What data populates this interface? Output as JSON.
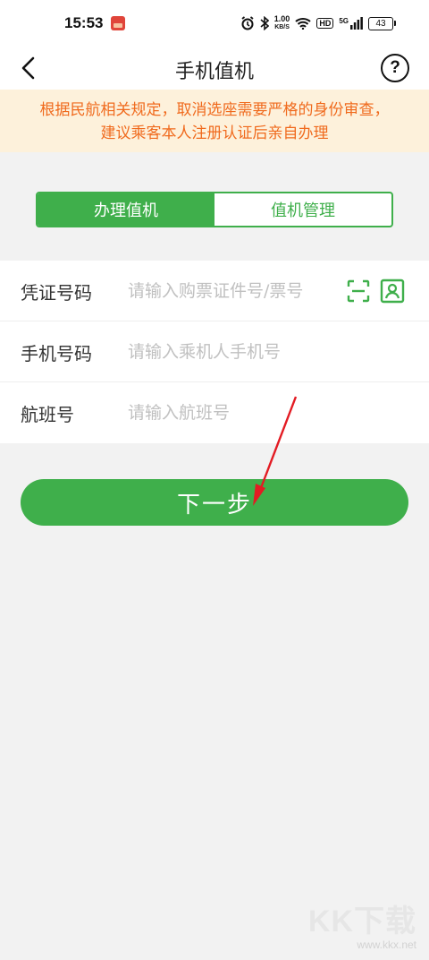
{
  "status_bar": {
    "time": "15:53",
    "speed_value": "1.00",
    "speed_unit": "KB/S",
    "hd": "HD",
    "network": "5G",
    "battery": "43"
  },
  "nav": {
    "title": "手机值机",
    "help_symbol": "?"
  },
  "notice": {
    "line1": "根据民航相关规定，取消选座需要严格的身份审查，",
    "line2": "建议乘客本人注册认证后亲自办理",
    "color": "#f06a1d",
    "background": "#fdf1db"
  },
  "tabs": [
    {
      "label": "办理值机",
      "active": true
    },
    {
      "label": "值机管理",
      "active": false
    }
  ],
  "form": {
    "ticket": {
      "label": "凭证号码",
      "placeholder": "请输入购票证件号/票号",
      "value": ""
    },
    "phone": {
      "label": "手机号码",
      "placeholder": "请输入乘机人手机号",
      "value": ""
    },
    "flight": {
      "label": "航班号",
      "placeholder": "请输入航班号",
      "value": ""
    }
  },
  "next_button": {
    "label": "下一步"
  },
  "watermark": {
    "logo": "KK下载",
    "url": "www.kkx.net"
  },
  "colors": {
    "accent": "#3faf4b",
    "annotation_arrow": "#e31b23"
  }
}
